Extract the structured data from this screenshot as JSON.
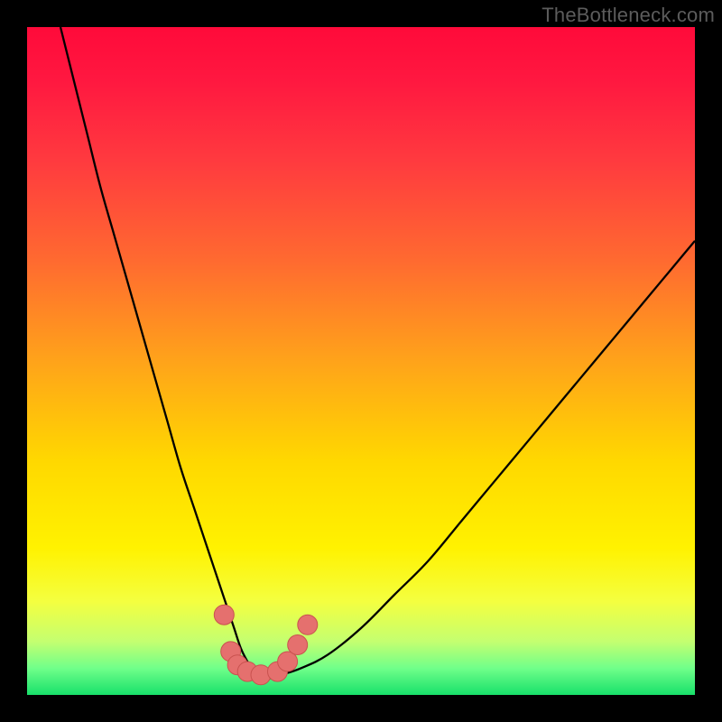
{
  "watermark": "TheBottleneck.com",
  "colors": {
    "gradient_stops": [
      {
        "offset": 0.0,
        "color": "#ff0a3a"
      },
      {
        "offset": 0.08,
        "color": "#ff1840"
      },
      {
        "offset": 0.2,
        "color": "#ff3a3f"
      },
      {
        "offset": 0.35,
        "color": "#ff6a30"
      },
      {
        "offset": 0.5,
        "color": "#ffa31a"
      },
      {
        "offset": 0.65,
        "color": "#ffd800"
      },
      {
        "offset": 0.78,
        "color": "#fff200"
      },
      {
        "offset": 0.86,
        "color": "#f4ff40"
      },
      {
        "offset": 0.92,
        "color": "#c4ff70"
      },
      {
        "offset": 0.96,
        "color": "#70ff8a"
      },
      {
        "offset": 1.0,
        "color": "#18e06a"
      }
    ],
    "curve": "#000000",
    "markers_fill": "#e5706e",
    "markers_stroke": "#c9524f"
  },
  "chart_data": {
    "type": "line",
    "title": "",
    "xlabel": "",
    "ylabel": "",
    "xlim": [
      0,
      100
    ],
    "ylim": [
      0,
      100
    ],
    "grid": false,
    "series": [
      {
        "name": "bottleneck-curve",
        "x": [
          5,
          7,
          9,
          11,
          13,
          15,
          17,
          19,
          21,
          23,
          25,
          27,
          29,
          30,
          31,
          32,
          33,
          34,
          36,
          38,
          41,
          45,
          50,
          55,
          60,
          65,
          70,
          75,
          80,
          85,
          90,
          95,
          100
        ],
        "y": [
          100,
          92,
          84,
          76,
          69,
          62,
          55,
          48,
          41,
          34,
          28,
          22,
          16,
          13,
          10,
          7,
          5,
          3.5,
          2.5,
          3,
          4,
          6,
          10,
          15,
          20,
          26,
          32,
          38,
          44,
          50,
          56,
          62,
          68
        ]
      }
    ],
    "markers": [
      {
        "x": 29.5,
        "y": 12
      },
      {
        "x": 30.5,
        "y": 6.5
      },
      {
        "x": 31.5,
        "y": 4.5
      },
      {
        "x": 33.0,
        "y": 3.5
      },
      {
        "x": 35.0,
        "y": 3.0
      },
      {
        "x": 37.5,
        "y": 3.5
      },
      {
        "x": 39.0,
        "y": 5.0
      },
      {
        "x": 40.5,
        "y": 7.5
      },
      {
        "x": 42.0,
        "y": 10.5
      }
    ]
  }
}
